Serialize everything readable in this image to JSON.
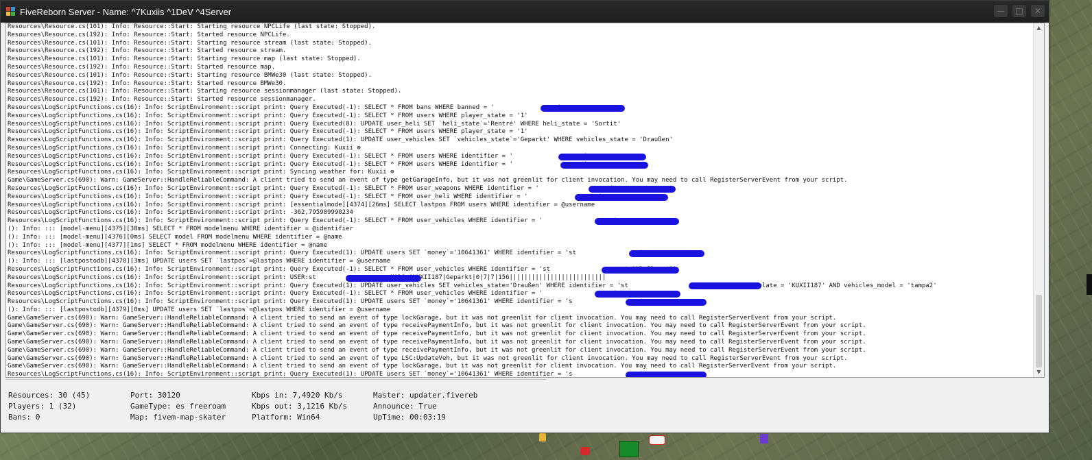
{
  "window": {
    "title": "FiveReborn Server - Name: ^7Kuxiis ^1DeV ^4Server",
    "minimize_glyph": "—",
    "maximize_glyph": "□",
    "close_glyph": "✕"
  },
  "scrollbar": {
    "up_glyph": "▲",
    "down_glyph": "▼"
  },
  "log_lines": [
    "Resources\\Resource.cs(101): Info: Resource::Start: Starting resource NPCLife (last state: Stopped).",
    "Resources\\Resource.cs(192): Info: Resource::Start: Started resource NPCLife.",
    "Resources\\Resource.cs(101): Info: Resource::Start: Starting resource stream (last state: Stopped).",
    "Resources\\Resource.cs(192): Info: Resource::Start: Started resource stream.",
    "Resources\\Resource.cs(101): Info: Resource::Start: Starting resource map (last state: Stopped).",
    "Resources\\Resource.cs(192): Info: Resource::Start: Started resource map.",
    "Resources\\Resource.cs(101): Info: Resource::Start: Starting resource BMWe30 (last state: Stopped).",
    "Resources\\Resource.cs(192): Info: Resource::Start: Started resource BMWe30.",
    "Resources\\Resource.cs(101): Info: Resource::Start: Starting resource sessionmanager (last state: Stopped).",
    "Resources\\Resource.cs(192): Info: Resource::Start: Started resource sessionmanager.",
    "Resources\\LogScriptFunctions.cs(16): Info: ScriptEnvironment::script print: Query Executed(-1): SELECT * FROM bans WHERE banned = '                 '",
    "Resources\\LogScriptFunctions.cs(16): Info: ScriptEnvironment::script print: Query Executed(-1): SELECT * FROM users WHERE player_state = '1'",
    "Resources\\LogScriptFunctions.cs(16): Info: ScriptEnvironment::script print: Query Executed(0): UPDATE user_heli SET `heli_state`='Rentré' WHERE heli_state = 'Sortit'",
    "Resources\\LogScriptFunctions.cs(16): Info: ScriptEnvironment::script print: Query Executed(-1): SELECT * FROM users WHERE player_state = '1'",
    "Resources\\LogScriptFunctions.cs(16): Info: ScriptEnvironment::script print: Query Executed(1): UPDATE user_vehicles SET `vehicles_state`='Geparkt' WHERE vehicles_state = 'Draußen'",
    "Resources\\LogScriptFunctions.cs(16): Info: ScriptEnvironment::script print: Connecting: Kuxii ⊕",
    "Resources\\LogScriptFunctions.cs(16): Info: ScriptEnvironment::script print: Query Executed(-1): SELECT * FROM users WHERE identifier = '                   '",
    "Resources\\LogScriptFunctions.cs(16): Info: ScriptEnvironment::script print: Query Executed(-1): SELECT * FROM users WHERE identifier = '                   '",
    "Resources\\LogScriptFunctions.cs(16): Info: ScriptEnvironment::script print: Syncing weather for: Kuxii ⊕",
    "Game\\GameServer.cs(690): Warn: GameServer::HandleReliableCommand: A client tried to send an event of type getGarageInfo, but it was not greenlit for client invocation. You may need to call RegisterServerEvent from your script.",
    "Resources\\LogScriptFunctions.cs(16): Info: ScriptEnvironment::script print: Query Executed(-1): SELECT * FROM user_weapons WHERE identifier = '                   '",
    "Resources\\LogScriptFunctions.cs(16): Info: ScriptEnvironment::script print: Query Executed(-1): SELECT * FROM user_heli WHERE identifier = '                   '",
    "Resources\\LogScriptFunctions.cs(16): Info: ScriptEnvironment::script print: [essentialmode][4374][26ms] SELECT lastpos FROM users WHERE identifier = @username",
    "Resources\\LogScriptFunctions.cs(16): Info: ScriptEnvironment::script print: -362,795989990234",
    "Resources\\LogScriptFunctions.cs(16): Info: ScriptEnvironment::script print: Query Executed(-1): SELECT * FROM user_vehicles WHERE identifier = '                   '",
    "(): Info: ::: [model-menu][4375][38ms] SELECT * FROM modelmenu WHERE identifier = @identifier",
    "(): Info: ::: [model-menu][4376][0ms] SELECT model FROM modelmenu WHERE identifier = @name",
    "(): Info: ::: [model-menu][4377][1ms] SELECT * FROM modelmenu WHERE identifier = @name",
    "Resources\\LogScriptFunctions.cs(16): Info: ScriptEnvironment::script print: Query Executed(1): UPDATE users SET `money`='10641361' WHERE identifier = 'st                 '",
    "(): Info: ::: [lastpostodb][4378][3ms] UPDATE users SET `lastpos`=@lastpos WHERE identifier = @username",
    "Resources\\LogScriptFunctions.cs(16): Info: ScriptEnvironment::script print: Query Executed(-1): SELECT * FROM user_vehicles WHERE identifier = 'st                    ' AND ID = '1'",
    "Resources\\LogScriptFunctions.cs(16): Info: ScriptEnvironment::script print: USER:st                    MODS:|KUXII187|Geparkt|0|7|7|156||||||||||||||||||||||||||",
    "Resources\\LogScriptFunctions.cs(16): Info: ScriptEnvironment::script print: Query Executed(1): UPDATE user_vehicles SET vehicles_state='Draußen' WHERE identifier = 'st                    ' AND vehicles_plate = 'KUXII187' AND vehicles_model = 'tampa2'",
    "Resources\\LogScriptFunctions.cs(16): Info: ScriptEnvironment::script print: Query Executed(-1): SELECT * FROM user_vehicles WHERE identifier = '                   '",
    "Resources\\LogScriptFunctions.cs(16): Info: ScriptEnvironment::script print: Query Executed(1): UPDATE users SET `money`='10641361' WHERE identifier = 's                  '",
    "(): Info: ::: [lastpostodb][4379][0ms] UPDATE users SET `lastpos`=@lastpos WHERE identifier = @username",
    "Game\\GameServer.cs(690): Warn: GameServer::HandleReliableCommand: A client tried to send an event of type lockGarage, but it was not greenlit for client invocation. You may need to call RegisterServerEvent from your script.",
    "Game\\GameServer.cs(690): Warn: GameServer::HandleReliableCommand: A client tried to send an event of type receivePaymentInfo, but it was not greenlit for client invocation. You may need to call RegisterServerEvent from your script.",
    "Game\\GameServer.cs(690): Warn: GameServer::HandleReliableCommand: A client tried to send an event of type receivePaymentInfo, but it was not greenlit for client invocation. You may need to call RegisterServerEvent from your script.",
    "Game\\GameServer.cs(690): Warn: GameServer::HandleReliableCommand: A client tried to send an event of type receivePaymentInfo, but it was not greenlit for client invocation. You may need to call RegisterServerEvent from your script.",
    "Game\\GameServer.cs(690): Warn: GameServer::HandleReliableCommand: A client tried to send an event of type receivePaymentInfo, but it was not greenlit for client invocation. You may need to call RegisterServerEvent from your script.",
    "Game\\GameServer.cs(690): Warn: GameServer::HandleReliableCommand: A client tried to send an event of type LSC:UpdateVeh, but it was not greenlit for client invocation. You may need to call RegisterServerEvent from your script.",
    "Game\\GameServer.cs(690): Warn: GameServer::HandleReliableCommand: A client tried to send an event of type lockGarage, but it was not greenlit for client invocation. You may need to call RegisterServerEvent from your script.",
    "Resources\\LogScriptFunctions.cs(16): Info: ScriptEnvironment::script print: Query Executed(1): UPDATE users SET `money`='10641361' WHERE identifier = 's                  '"
  ],
  "stats": {
    "resources": "Resources: 30 (45)",
    "players": "Players: 1 (32)",
    "bans": "Bans: 0",
    "port": "Port: 30120",
    "gametype": "GameType: es freeroam",
    "map": "Map: fivem-map-skater",
    "kbps_in": "Kbps in: 7,4920 Kb/s",
    "kbps_out": "Kbps out: 3,1216 Kb/s",
    "platform": "Platform: Win64",
    "master": "Master: updater.fivereb",
    "announce": "Announce: True",
    "uptime": "UpTime: 00:03:19"
  },
  "colors": {
    "redaction": "#1a12e0",
    "titlebar": "#1f1f1f",
    "console_bg": "#ffffff"
  }
}
